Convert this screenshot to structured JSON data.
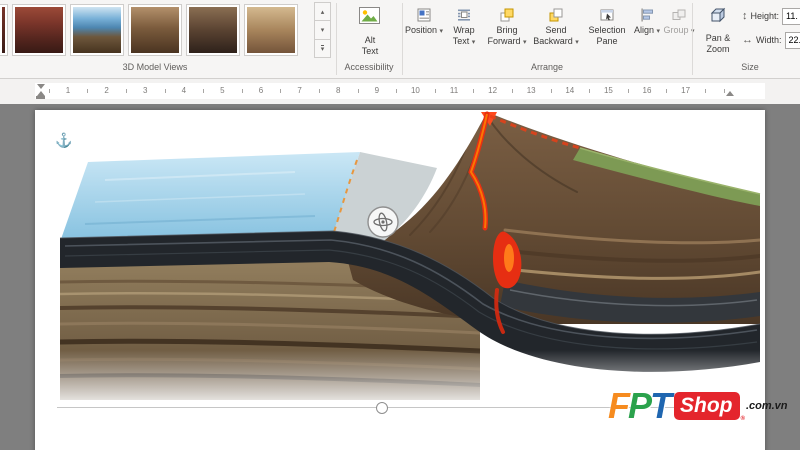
{
  "ribbon": {
    "gallery": {
      "label": "3D Model Views",
      "thumbnails": [
        "model-view-1",
        "model-view-2",
        "model-view-3",
        "model-view-4",
        "model-view-5",
        "model-view-6"
      ],
      "scroll_up": "▴",
      "scroll_down": "▾",
      "more": "▾"
    },
    "accessibility": {
      "label": "Accessibility",
      "alt_text": "Alt Text"
    },
    "arrange": {
      "label": "Arrange",
      "buttons": [
        {
          "label": "Position",
          "caret": "▾"
        },
        {
          "label": "Wrap Text",
          "caret": "▾"
        },
        {
          "label": "Bring Forward",
          "caret": "▾"
        },
        {
          "label": "Send Backward",
          "caret": "▾"
        },
        {
          "label": "Selection Pane",
          "caret": ""
        },
        {
          "label": "Align",
          "caret": "▾"
        },
        {
          "label": "Group",
          "caret": "▾"
        }
      ]
    },
    "size": {
      "label": "Size",
      "pan_zoom": "Pan & Zoom",
      "height_label": "Height:",
      "height_value": "11.",
      "width_label": "Width:",
      "width_value": "22.",
      "height_icon": "↕",
      "width_icon": "↔"
    }
  },
  "ruler": {
    "numbers": [
      "1",
      "2",
      "3",
      "4",
      "5",
      "6",
      "7",
      "8",
      "9",
      "10",
      "11",
      "12",
      "13",
      "14",
      "15",
      "16",
      "17"
    ]
  },
  "document": {
    "object": "3d-geology-subduction-volcano-model",
    "anchor_icon": "⚓"
  },
  "watermark": {
    "letters": {
      "f": "F",
      "p": "P",
      "t": "T"
    },
    "colors": {
      "f": "#F68B1F",
      "p": "#2BA24C",
      "t": "#1F66B0",
      "shop_bg": "#E4252C"
    },
    "shop": "Shop",
    "reg": "®",
    "domain": ".com.vn"
  }
}
